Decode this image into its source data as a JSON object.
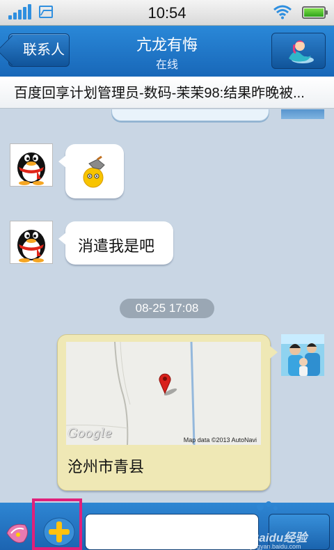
{
  "status_bar": {
    "time": "10:54",
    "signal_icon": "signal-bars-icon",
    "image_icon": "image-notification-icon",
    "wifi_icon": "wifi-icon",
    "battery_icon": "battery-icon",
    "battery_level": 1.0
  },
  "nav": {
    "back_label": "联系人",
    "title": "亢龙有悔",
    "status": "在线",
    "profile_icon": "mermaid-avatar-icon"
  },
  "marquee": {
    "text": "百度回享计划管理员-数码-茉茉98:结果昨晚被..."
  },
  "messages": [
    {
      "side": "left",
      "avatar": "qq-penguin-avatar",
      "type": "emoji",
      "emoji": "smiley-with-hat-emoji"
    },
    {
      "side": "left",
      "avatar": "qq-penguin-avatar",
      "type": "text",
      "text": "消遣我是吧"
    },
    {
      "type": "timestamp",
      "text": "08-25 17:08"
    },
    {
      "side": "right",
      "avatar": "family-photo-avatar",
      "type": "location",
      "place": "沧州市青县",
      "map_logo": "Google",
      "map_attribution": "Map data ©2013 AutoNavi"
    }
  ],
  "input_bar": {
    "shell_icon": "conch-shell-icon",
    "plus_icon": "plus-icon",
    "input_value": "",
    "send_label": "",
    "watermark": "Baidu经验",
    "watermark_sub": "jingyan.baidu.com"
  },
  "colors": {
    "nav_blue": "#1a6fc3",
    "map_bubble": "#efe8b5",
    "highlight": "#e0207a"
  }
}
